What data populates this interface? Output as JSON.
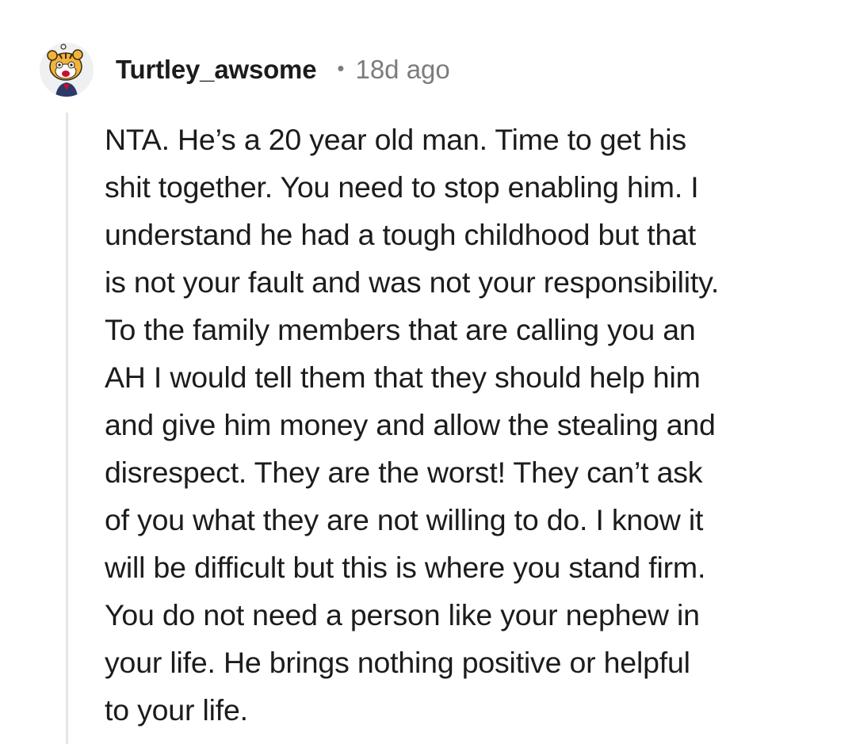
{
  "comment": {
    "username": "Turtley_awsome",
    "separator": "•",
    "age": "18d ago",
    "avatar_icon": "cartoon-tiger-avatar-icon",
    "body": "NTA. He’s a 20 year old man. Time to get his\nshit together. You need to stop enabling him. I\nunderstand he had a tough childhood but that\nis not your fault and was not your responsibility.\nTo the family members that are calling you an\nAH I would tell them that they should help him\nand give him money and allow the stealing and\ndisrespect. They are the worst! They can’t ask\nof you what they are not willing to do. I know it\nwill be difficult but this is where you stand firm.\nYou do not need a person like your nephew in\nyour life. He brings nothing positive or helpful\nto your life."
  },
  "colors": {
    "text": "#1c1c1c",
    "meta": "#7c7c7c",
    "thread_line": "#e4e6e8",
    "avatar_bg": "#eef0f2"
  }
}
